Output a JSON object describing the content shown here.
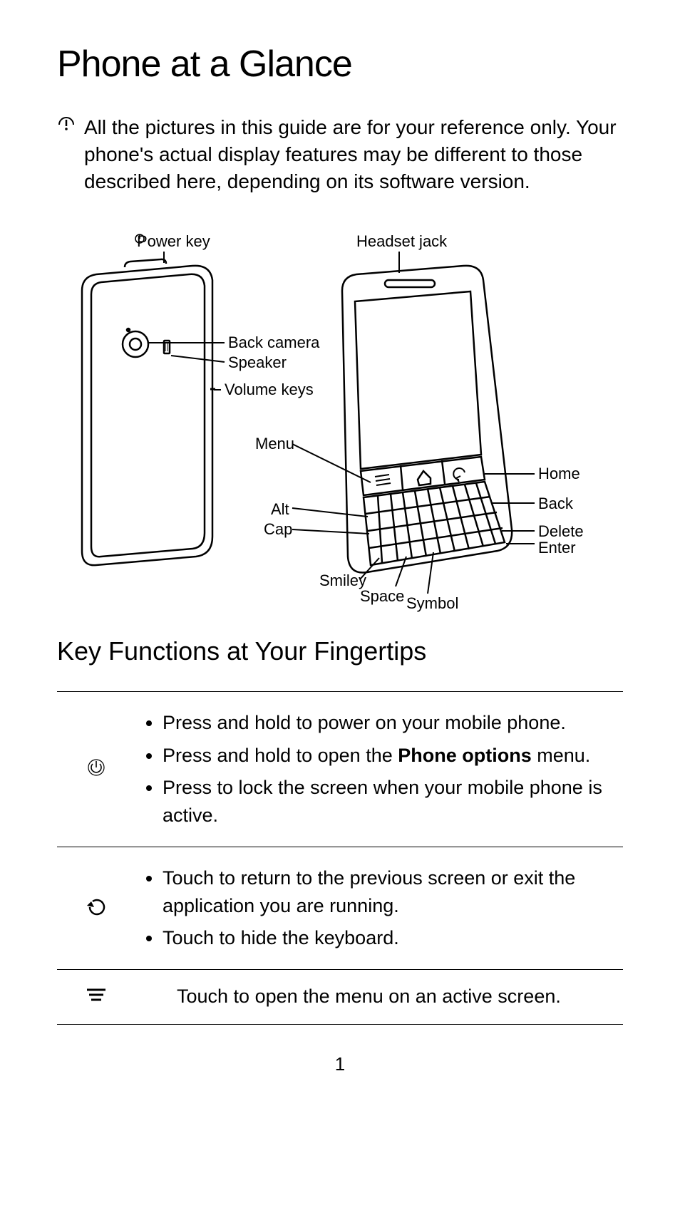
{
  "title": "Phone at a Glance",
  "notice": "All the pictures in this guide are for your reference only. Your phone's actual display features may be different to those described here, depending on its software version.",
  "diagram": {
    "power_key": "Power key",
    "headset_jack": "Headset jack",
    "back_camera": "Back camera",
    "speaker": "Speaker",
    "volume_keys": "Volume keys",
    "menu": "Menu",
    "home": "Home",
    "back": "Back",
    "alt": "Alt",
    "cap": "Cap",
    "delete": "Delete",
    "enter": "Enter",
    "smiley": "Smiley",
    "space": "Space",
    "symbol": "Symbol"
  },
  "section_title": "Key Functions at Your Fingertips",
  "rows": {
    "power": {
      "b1": "Press and hold to power on your mobile phone.",
      "b2a": "Press and hold to open the ",
      "b2b": "Phone options",
      "b2c": " menu.",
      "b3": "Press to lock the screen when your mobile phone is active."
    },
    "back": {
      "b1": "Touch to return to the previous screen or exit the application you are running.",
      "b2": "Touch to hide the keyboard."
    },
    "menu": {
      "text": "Touch to open the menu on an active screen."
    }
  },
  "page_number": "1"
}
